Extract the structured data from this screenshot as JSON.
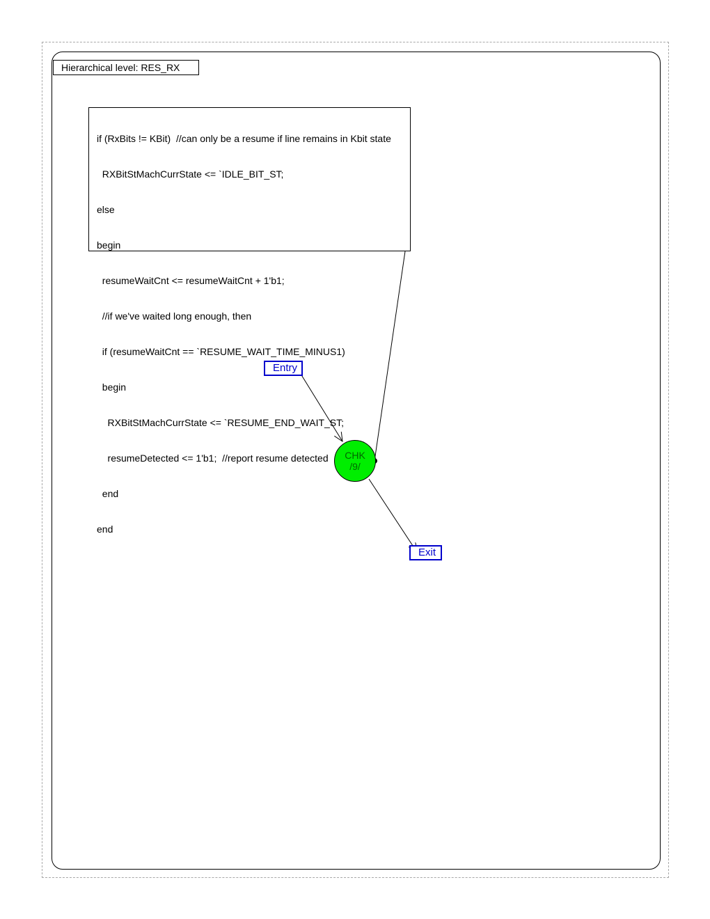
{
  "diagram": {
    "hierarchy_label": "Hierarchical level: RES_RX",
    "code_lines": [
      "if (RxBits != KBit)  //can only be a resume if line remains in Kbit state",
      "  RXBitStMachCurrState <= `IDLE_BIT_ST;",
      "else",
      "begin",
      "  resumeWaitCnt <= resumeWaitCnt + 1'b1;",
      "  //if we've waited long enough, then",
      "  if (resumeWaitCnt == `RESUME_WAIT_TIME_MINUS1)",
      "  begin",
      "    RXBitStMachCurrState <= `RESUME_END_WAIT_ST;",
      "    resumeDetected <= 1'b1;  //report resume detected",
      "  end",
      "end"
    ],
    "entry_label": "Entry",
    "exit_label": "Exit",
    "state": {
      "name": "CHK",
      "number": "/9/"
    },
    "colors": {
      "state_fill": "#00ee00",
      "state_text": "#006600",
      "port_border": "#0000cc",
      "frame_dashed": "#a8a8a8"
    }
  }
}
